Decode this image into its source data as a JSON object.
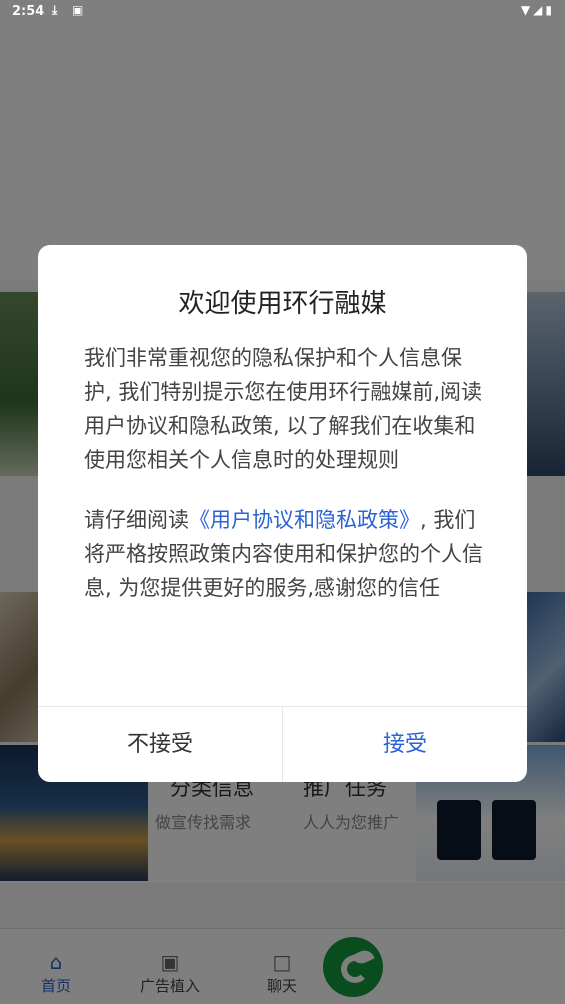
{
  "status_bar": {
    "time": "2:54",
    "left_icons": [
      "download-icon",
      "a-icon"
    ],
    "right_icons": [
      "wifi-icon",
      "signal-icon",
      "battery-icon"
    ]
  },
  "background": {
    "card_a": {
      "title": "分类信息",
      "subtitle": "做宣传找需求"
    },
    "card_b": {
      "title": "推广任务",
      "subtitle": "人人为您推广"
    }
  },
  "tabbar": {
    "home_label": "首页",
    "ad_label": "广告植入",
    "chat_label": "聊天",
    "active_color": "#2a5fcf"
  },
  "dialog": {
    "title": "欢迎使用环行融媒",
    "para1": "我们非常重视您的隐私保护和个人信息保护, 我们特别提示您在使用环行融媒前,阅读用户协议和隐私政策, 以了解我们在收集和使用您相关个人信息时的处理规则",
    "para2_prefix": "请仔细阅读",
    "para2_link": "《用户协议和隐私政策》",
    "para2_suffix": ", 我们将严格按照政策内容使用和保护您的个人信息, 为您提供更好的服务,感谢您的信任",
    "decline_label": "不接受",
    "accept_label": "接受",
    "link_color": "#2a63d6"
  }
}
